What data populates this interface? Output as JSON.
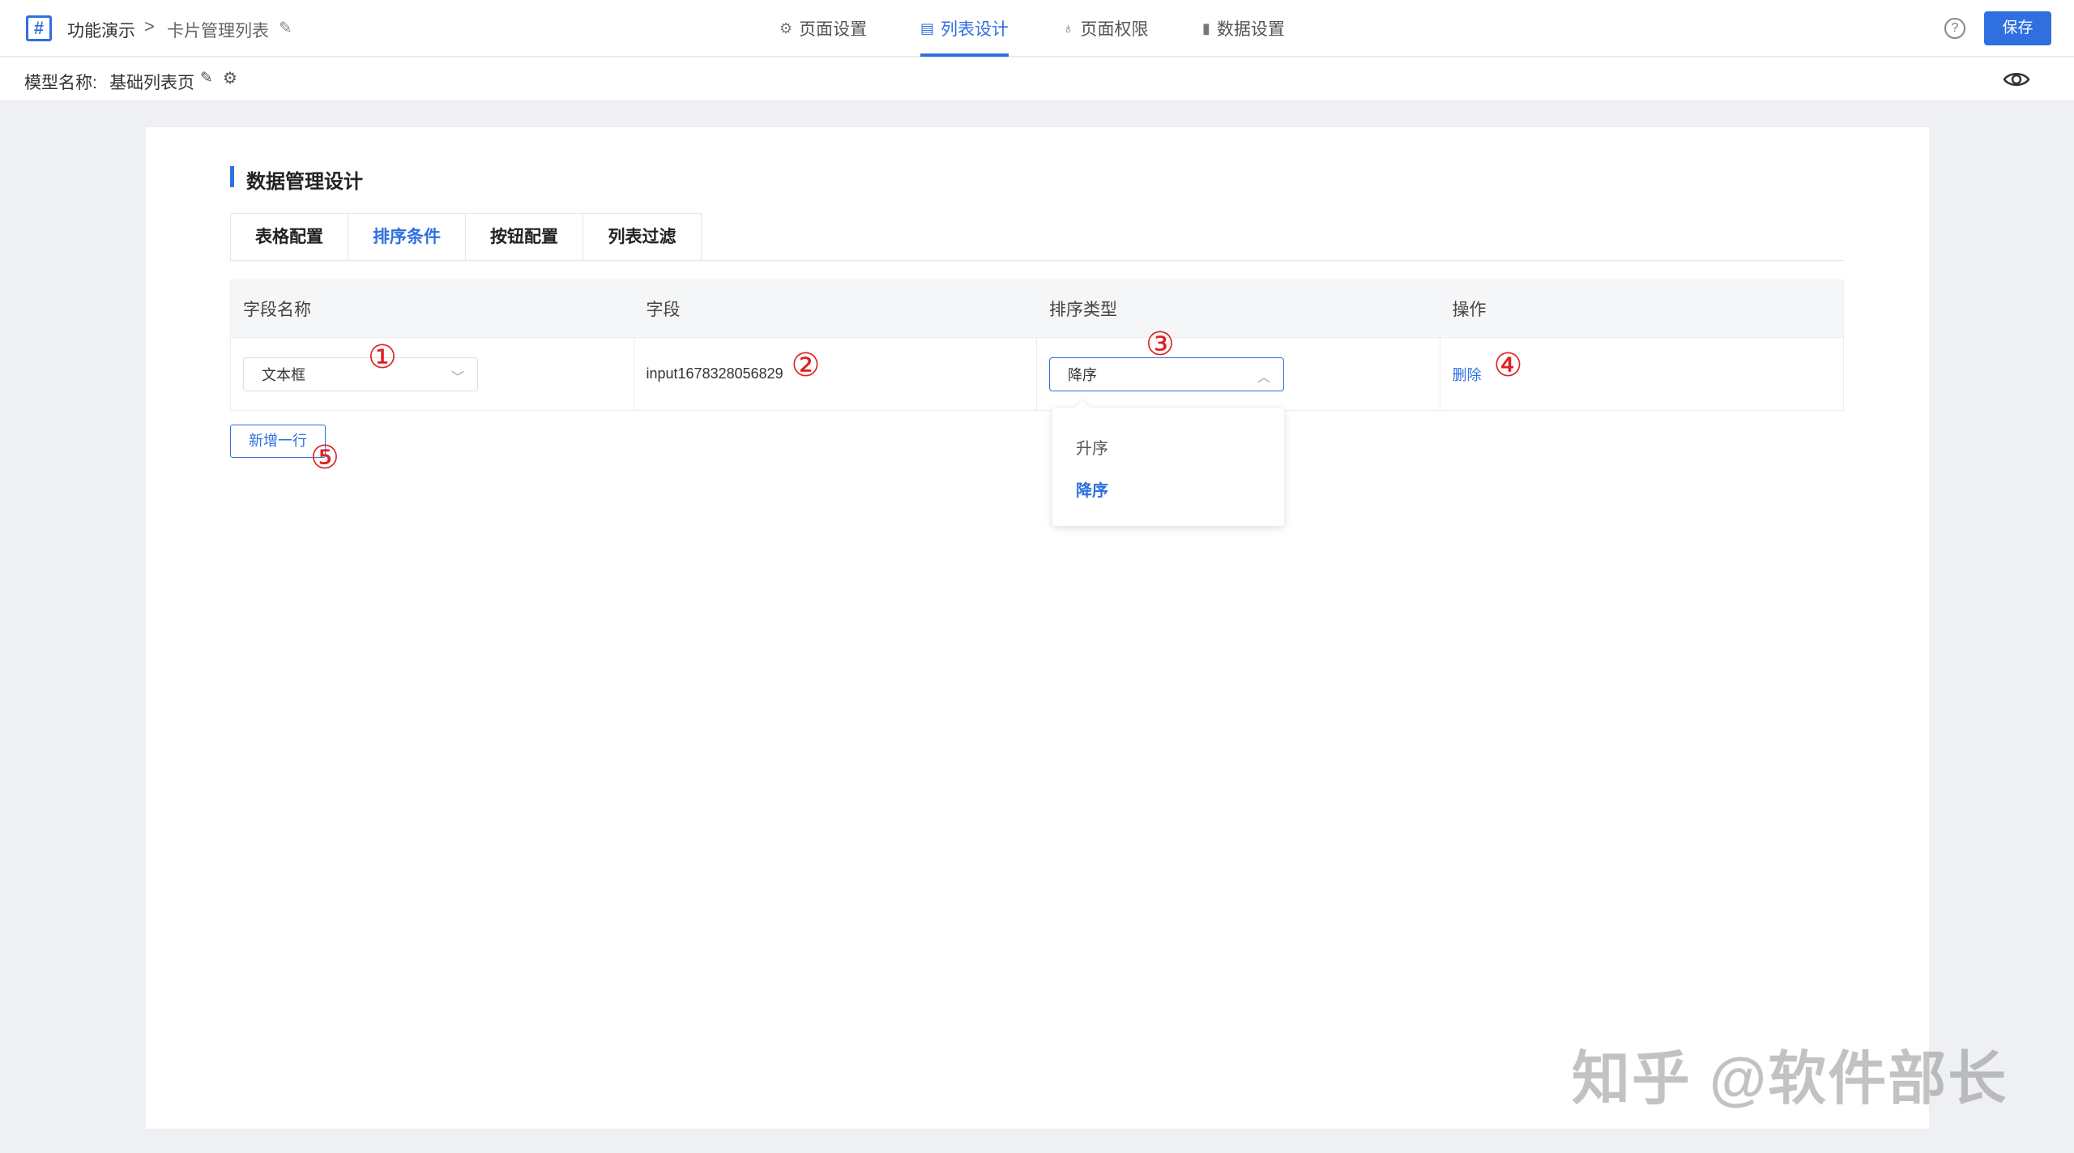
{
  "header": {
    "breadcrumb": [
      "功能演示",
      "卡片管理列表"
    ],
    "separator": ">",
    "nav": [
      {
        "label": "页面设置",
        "icon": "gear-icon",
        "glyph": "⚙",
        "active": false
      },
      {
        "label": "列表设计",
        "icon": "list-design-icon",
        "glyph": "▤",
        "active": true
      },
      {
        "label": "页面权限",
        "icon": "key-icon",
        "glyph": "♁",
        "active": false
      },
      {
        "label": "数据设置",
        "icon": "bar-chart-icon",
        "glyph": "▮",
        "active": false
      }
    ],
    "help_glyph": "?",
    "save_label": "保存"
  },
  "model": {
    "label": "模型名称:",
    "value": "基础列表页"
  },
  "section": {
    "title": "数据管理设计",
    "tabs": [
      {
        "label": "表格配置",
        "active": false
      },
      {
        "label": "排序条件",
        "active": true
      },
      {
        "label": "按钮配置",
        "active": false
      },
      {
        "label": "列表过滤",
        "active": false
      }
    ]
  },
  "table": {
    "columns": [
      "字段名称",
      "字段",
      "排序类型",
      "操作"
    ],
    "rows": [
      {
        "field_name": "文本框",
        "field": "input1678328056829",
        "sort_type": "降序",
        "action": "删除"
      }
    ]
  },
  "dropdown": {
    "options": [
      "升序",
      "降序"
    ],
    "selected": "降序"
  },
  "add_row_label": "新增一行",
  "annotations": [
    "①",
    "②",
    "③",
    "④",
    "⑤"
  ],
  "watermark": "知乎 @软件部长",
  "colors": {
    "accent": "#2f6fe0",
    "annotation": "#e02020",
    "background": "#eff0f3"
  }
}
